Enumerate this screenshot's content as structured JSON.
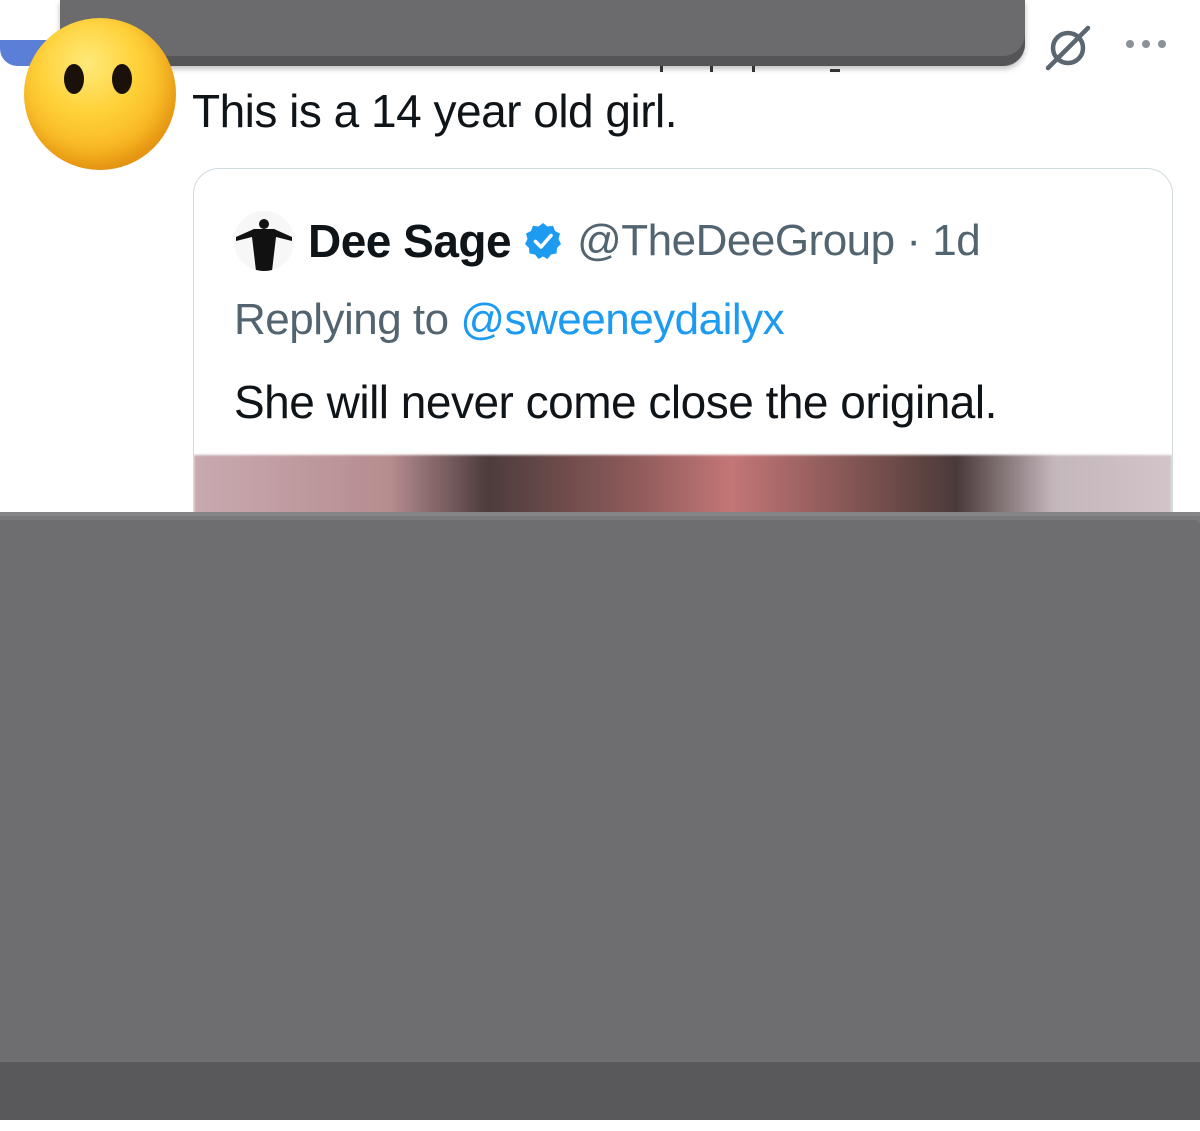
{
  "post": {
    "text": "This is a 14 year old girl.",
    "avatar_icon": "no-mouth-emoji"
  },
  "actions": {
    "grok_icon": "grok-icon",
    "more_icon": "more-options-icon"
  },
  "quote": {
    "name": "Dee Sage",
    "handle_time": "@TheDeeGroup · 1d",
    "reply_prefix": "Replying to ",
    "reply_mention": "@sweeneydailyx",
    "body": "She will never come close the original.",
    "verified": true
  },
  "colors": {
    "redaction": "#6e6e70",
    "link": "#1d9bf0",
    "secondary_text": "#536471"
  }
}
